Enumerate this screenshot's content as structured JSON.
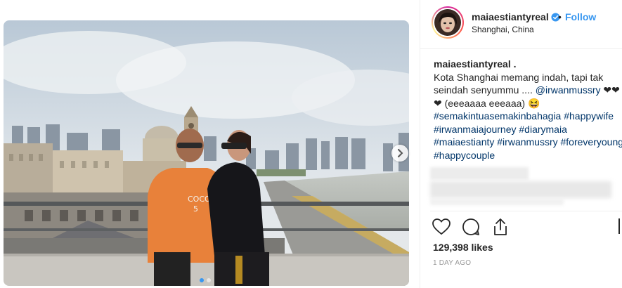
{
  "post": {
    "username": "maiaestiantyreal",
    "follow_separator": "•",
    "follow_label": "Follow",
    "location": "Shanghai, China",
    "caption_user": "maiaestiantyreal .",
    "caption_line1": "Kota Shanghai memang indah, tapi tak",
    "caption_line2_text": "seindah senyummu .... ",
    "caption_mention": "@irwanmussry",
    "caption_line2_hearts": " ❤❤",
    "caption_line3": "❤ (eeeaaaa eeeaaa) 😆",
    "hashtags_line1": "#semakintuasemakinbahagia #happywife",
    "hashtags_line2": "#irwanmaiajourney #diarymaia",
    "hashtags_line3": "#maiaestianty #irwanmussry #foreveryoung",
    "hashtags_line4": "#happycouple",
    "likes": "129,398 likes",
    "time": "1 DAY AGO"
  },
  "icons": {
    "verified": "verified-badge-icon",
    "like": "heart-icon",
    "comment": "comment-icon",
    "share": "share-icon",
    "save": "bookmark-icon",
    "next": "chevron-right-icon"
  },
  "colors": {
    "link_blue": "#3897f0",
    "hashtag": "#003569",
    "text": "#262626",
    "muted": "#999999",
    "sweatshirt": "#e8813a"
  }
}
